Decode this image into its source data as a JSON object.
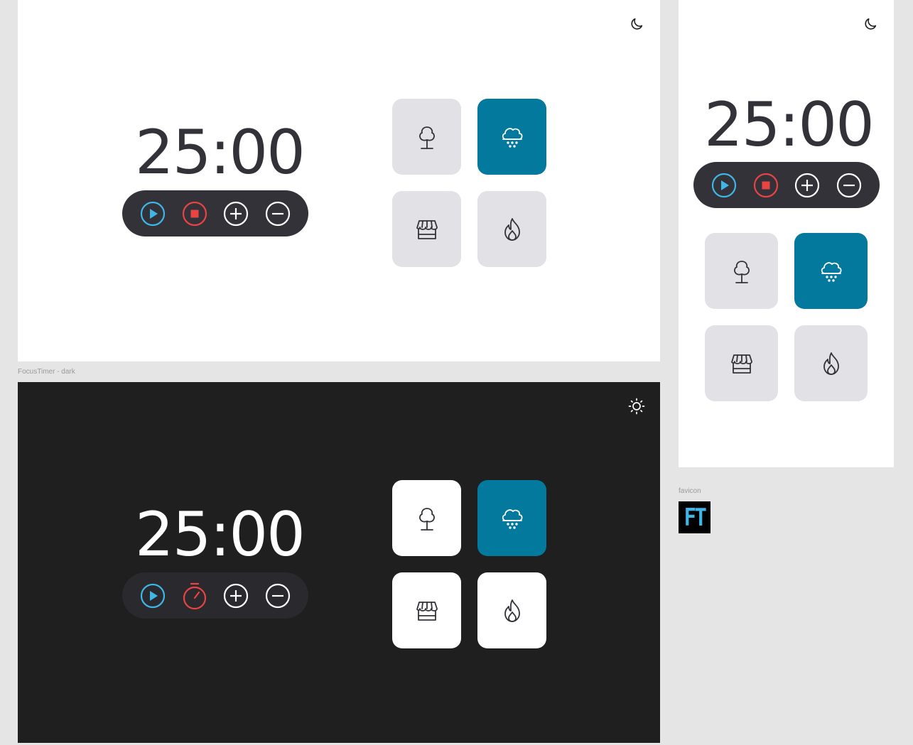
{
  "colors": {
    "light_bg": "#ffffff",
    "dark_bg": "#1f1f1f",
    "canvas_bg": "#e5e5e5",
    "timer_text_light": "#323238",
    "timer_text_dark": "#ffffff",
    "control_bar_light": "#323238",
    "control_bar_dark": "#29292e",
    "card_light": "#e1e1e6",
    "card_dark_mode": "#ffffff",
    "card_active": "#02799d",
    "play_color": "#3fb6e8",
    "stop_color": "#ea4343",
    "icon_color_light": "#323238",
    "favicon_text": "#3fb6e8"
  },
  "frames": {
    "dark_label": "FocusTimer - dark",
    "favicon_label": "favicon"
  },
  "timer": {
    "display": "25:00"
  },
  "icons": {
    "theme_light_mode": "moon-icon",
    "theme_dark_mode": "sun-icon",
    "play": "play-icon",
    "stop": "stop-icon",
    "timer_dark": "stopwatch-icon",
    "add": "plus-icon",
    "subtract": "minus-icon",
    "sounds": [
      "tree-icon",
      "cloud-rain-icon",
      "store-icon",
      "fire-icon"
    ]
  },
  "sounds": {
    "active_index": 1,
    "items": [
      "forest",
      "rain",
      "coffee-shop",
      "fireplace"
    ]
  },
  "favicon": {
    "text": "FT"
  }
}
